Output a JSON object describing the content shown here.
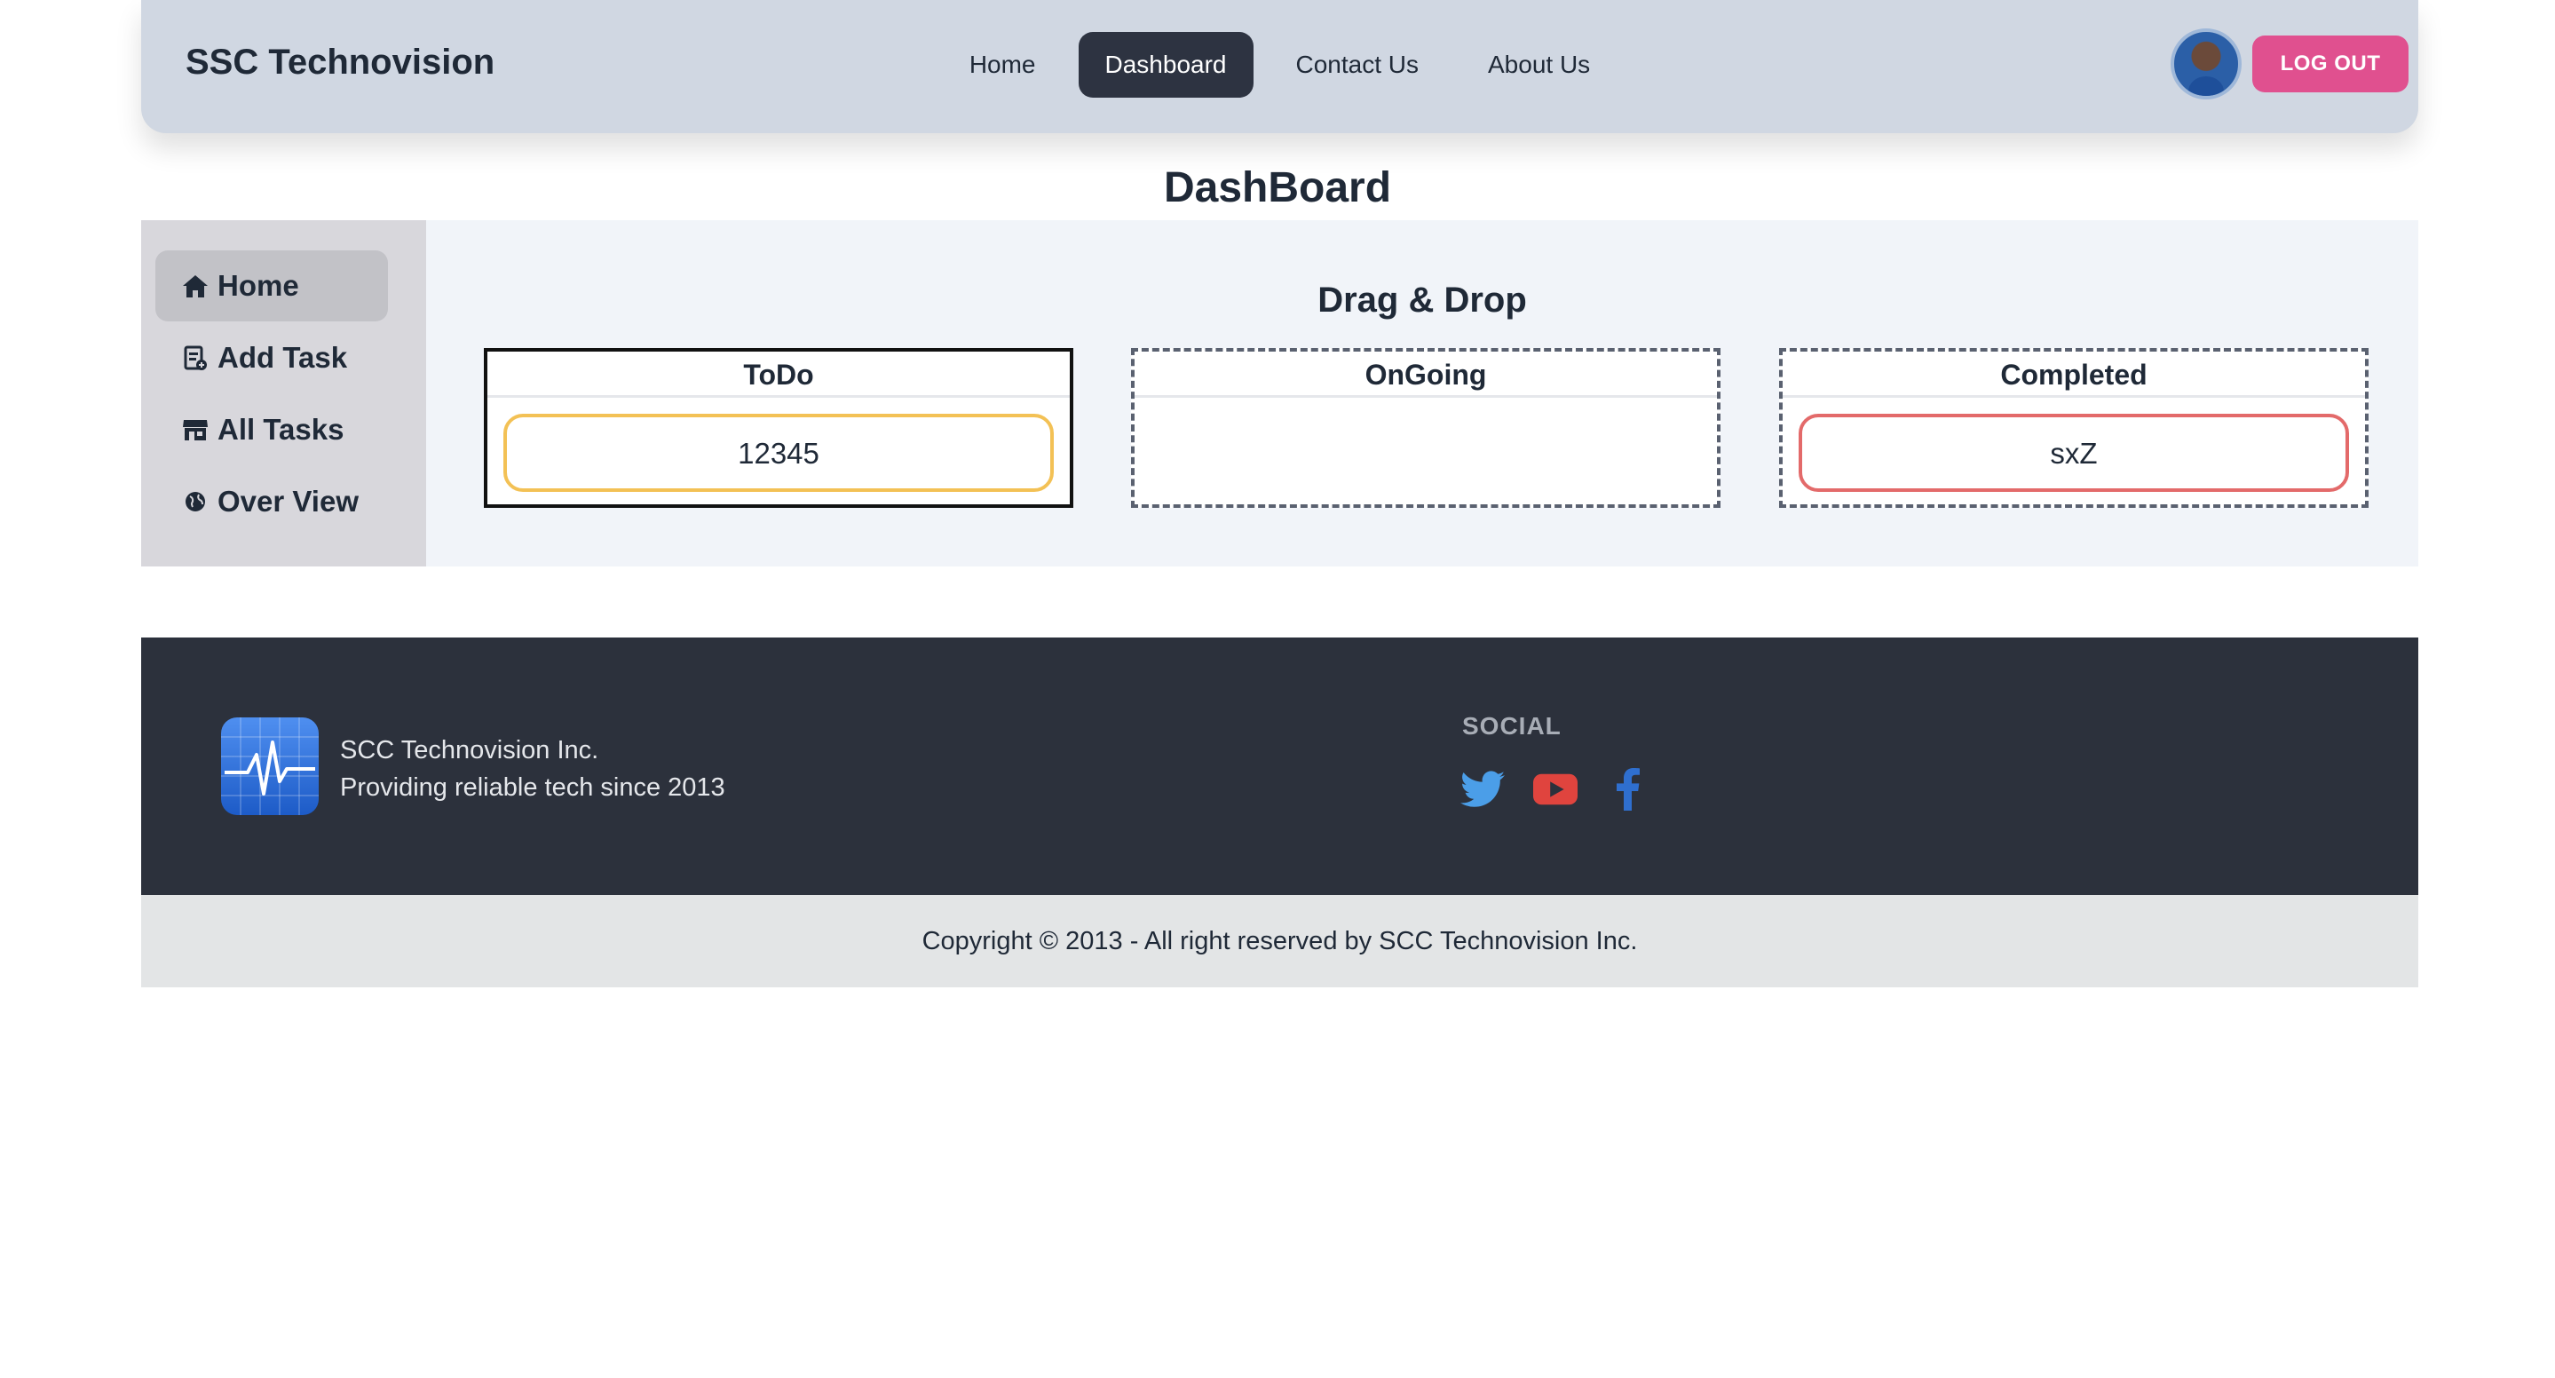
{
  "header": {
    "brand": "SSC Technovision",
    "nav": [
      "Home",
      "Dashboard",
      "Contact Us",
      "About Us"
    ],
    "active_nav": "Dashboard",
    "logout_label": "LOG OUT"
  },
  "page_title": "DashBoard",
  "sidebar": {
    "items": [
      {
        "label": "Home",
        "icon": "home-icon",
        "active": true
      },
      {
        "label": "Add Task",
        "icon": "add-task-icon",
        "active": false
      },
      {
        "label": "All Tasks",
        "icon": "store-icon",
        "active": false
      },
      {
        "label": "Over View",
        "icon": "globe-icon",
        "active": false
      }
    ]
  },
  "board": {
    "title": "Drag & Drop",
    "columns": [
      {
        "title": "ToDo",
        "cards": [
          "12345"
        ]
      },
      {
        "title": "OnGoing",
        "cards": []
      },
      {
        "title": "Completed",
        "cards": [
          "sxZ"
        ]
      }
    ]
  },
  "footer": {
    "company": "SCC Technovision Inc.",
    "tagline": "Providing reliable tech since 2013",
    "social_title": "SOCIAL",
    "social_icons": [
      "twitter-icon",
      "youtube-icon",
      "facebook-icon"
    ],
    "copyright": "Copyright © 2013 - All right reserved by SCC Technovision Inc."
  },
  "colors": {
    "navbar_bg": "#d0d7e2",
    "active_nav_bg": "#2d3341",
    "logout_bg": "#e0508f",
    "todo_card_border": "#f3c155",
    "completed_card_border": "#e36a6a",
    "footer_bg": "#2c313c",
    "twitter": "#4b9ee8",
    "youtube": "#e0443e",
    "facebook": "#2f6fcf"
  }
}
